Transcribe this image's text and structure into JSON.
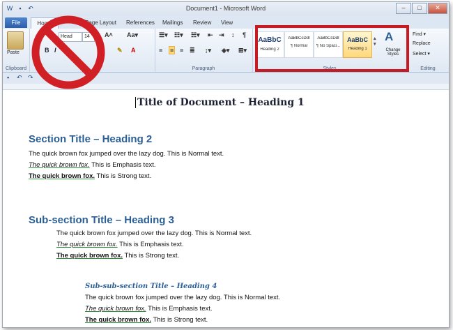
{
  "window": {
    "title": "Document1 - Microsoft Word",
    "controls": {
      "minimize": "–",
      "maximize": "□",
      "close": "✕"
    }
  },
  "tabs": [
    {
      "label": "File"
    },
    {
      "label": "Home"
    },
    {
      "label": "Page Layout"
    },
    {
      "label": "References"
    },
    {
      "label": "Mailings"
    },
    {
      "label": "Review"
    },
    {
      "label": "View"
    }
  ],
  "ribbon": {
    "clipboard": {
      "paste_label": "Paste",
      "group_label": "Clipboard"
    },
    "font": {
      "font_name": "Head",
      "font_size": "14",
      "bold": "B",
      "italic": "I"
    },
    "paragraph": {
      "group_label": "Paragraph"
    },
    "styles": {
      "group_label": "Styles",
      "items": [
        {
          "preview": "AaBbC",
          "name": "Heading 2"
        },
        {
          "preview": "AaBbCcDdI",
          "name": "¶ Normal"
        },
        {
          "preview": "AaBbCcDdI",
          "name": "¶ No Spaci..."
        },
        {
          "preview": "AaBbC",
          "name": "Heading 1"
        }
      ],
      "change_styles_label": "Change Styles"
    },
    "editing": {
      "group_label": "Editing",
      "find": "Find ▾",
      "replace": "Replace",
      "select": "Select ▾"
    }
  },
  "overlay": {
    "no_sign_color": "#d11f26",
    "highlight_color": "#c91a21"
  },
  "document": {
    "title": "Title of Document – Heading 1",
    "section": {
      "heading": "Section Title – Heading 2",
      "normal": "The quick brown fox jumped over the lazy dog. This is Normal text.",
      "em_phrase": "The quick brown fox.",
      "em_tail": " This is Emphasis text.",
      "strong_phrase": "The quick brown fox.",
      "strong_tail": " This is Strong text."
    },
    "subsection": {
      "heading": "Sub-section Title – Heading 3",
      "normal": "The quick brown fox jumped over the lazy dog. This is Normal text.",
      "em_phrase": "The quick brown fox.",
      "em_tail": " This is Emphasis text.",
      "strong_phrase": "The quick brown fox.",
      "strong_tail": " This is Strong text."
    },
    "subsubsection": {
      "heading": "Sub-sub-section Title – Heading 4",
      "normal": "The quick brown fox jumped over the lazy dog. This is Normal text.",
      "em_phrase": "The quick brown fox.",
      "em_tail": " This is Emphasis text.",
      "strong_phrase": "The quick brown fox.",
      "strong_tail": " This is Strong text."
    }
  }
}
